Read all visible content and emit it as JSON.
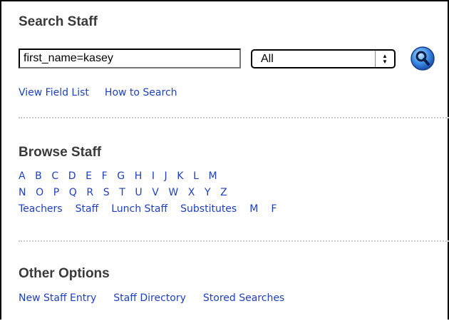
{
  "search": {
    "title": "Search Staff",
    "query_value": "first_name=kasey",
    "scope_selected": "All",
    "links": [
      "View Field List",
      "How to Search"
    ]
  },
  "browse": {
    "title": "Browse Staff",
    "letters_row1": [
      "A",
      "B",
      "C",
      "D",
      "E",
      "F",
      "G",
      "H",
      "I",
      "J",
      "K",
      "L",
      "M"
    ],
    "letters_row2": [
      "N",
      "O",
      "P",
      "Q",
      "R",
      "S",
      "T",
      "U",
      "V",
      "W",
      "X",
      "Y",
      "Z"
    ],
    "categories": [
      "Teachers",
      "Staff",
      "Lunch Staff",
      "Substitutes",
      "M",
      "F"
    ]
  },
  "other": {
    "title": "Other Options",
    "links": [
      "New Staff Entry",
      "Staff Directory",
      "Stored Searches"
    ]
  },
  "icons": {
    "search_button": "magnifier-icon",
    "select_arrows": "updown-arrows-icon"
  },
  "colors": {
    "link": "#1f3fbf",
    "heading": "#3a3a3a",
    "search_button": "#2f7fe0"
  }
}
